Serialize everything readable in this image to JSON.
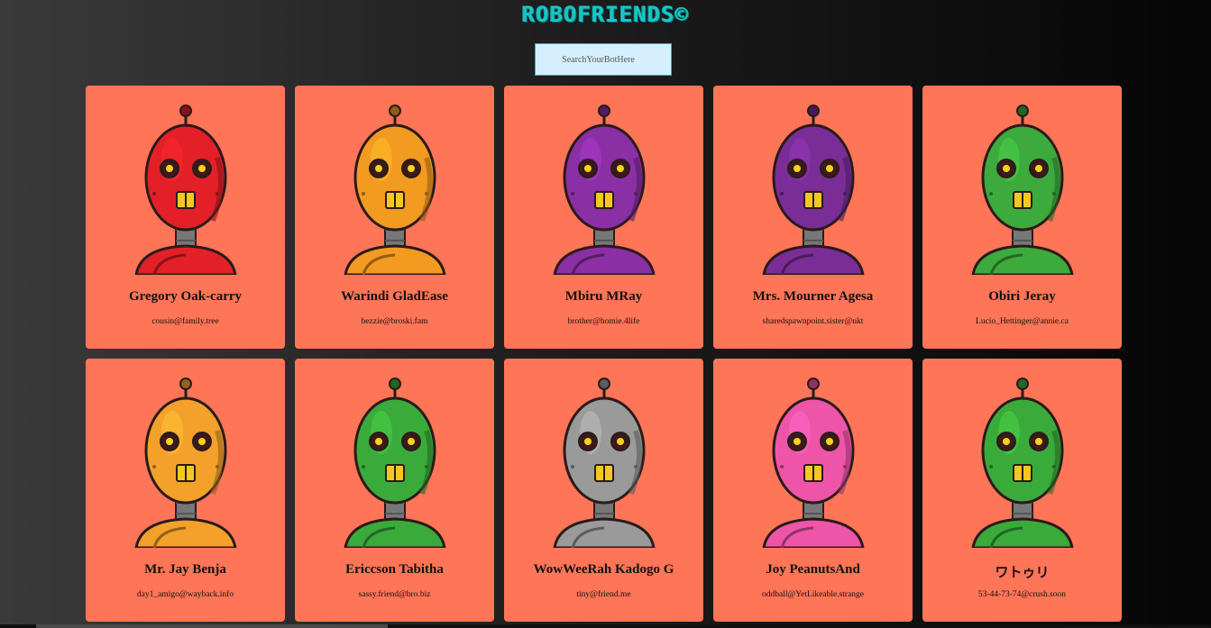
{
  "app": {
    "title": "ROBOFRIENDS©"
  },
  "search": {
    "placeholder": "SearchYourBotHere"
  },
  "robots": [
    {
      "name": "Gregory Oak-carry",
      "email": "cousin@family.tree",
      "color": "#e32027",
      "icon": "red-robot-icon"
    },
    {
      "name": "Warindi GladEase",
      "email": "bezzie@broski.fam",
      "color": "#f39a21",
      "icon": "orange-robot-icon"
    },
    {
      "name": "Mbiru MRay",
      "email": "brother@homie.4life",
      "color": "#8b2fa5",
      "icon": "purple-robot-icon"
    },
    {
      "name": "Mrs. Mourner Agesa",
      "email": "sharedspawnpoint.sister@nkt",
      "color": "#7a2d96",
      "icon": "purple-robot-icon"
    },
    {
      "name": "Obiri Jeray",
      "email": "Lucio_Hettinger@annie.ca",
      "color": "#3daa3d",
      "icon": "green-robot-icon"
    },
    {
      "name": "Mr. Jay Benja",
      "email": "day1_amigo@wayback.info",
      "color": "#f3a12a",
      "icon": "orange-robot-icon"
    },
    {
      "name": "Ericcson Tabitha",
      "email": "sassy.friend@bro.biz",
      "color": "#3aab3a",
      "icon": "green-robot-icon"
    },
    {
      "name": "WowWeeRah Kadogo G",
      "email": "tiny@friend.me",
      "color": "#9a9a9a",
      "icon": "gray-robot-icon"
    },
    {
      "name": "Joy PeanutsAnd",
      "email": "oddball@YetLikeable.strange",
      "color": "#ee55a8",
      "icon": "pink-robot-icon"
    },
    {
      "name": "ワトゥリ",
      "email": "53-44-73-74@crush.soon",
      "color": "#3aab3a",
      "icon": "green-robot-icon"
    }
  ]
}
